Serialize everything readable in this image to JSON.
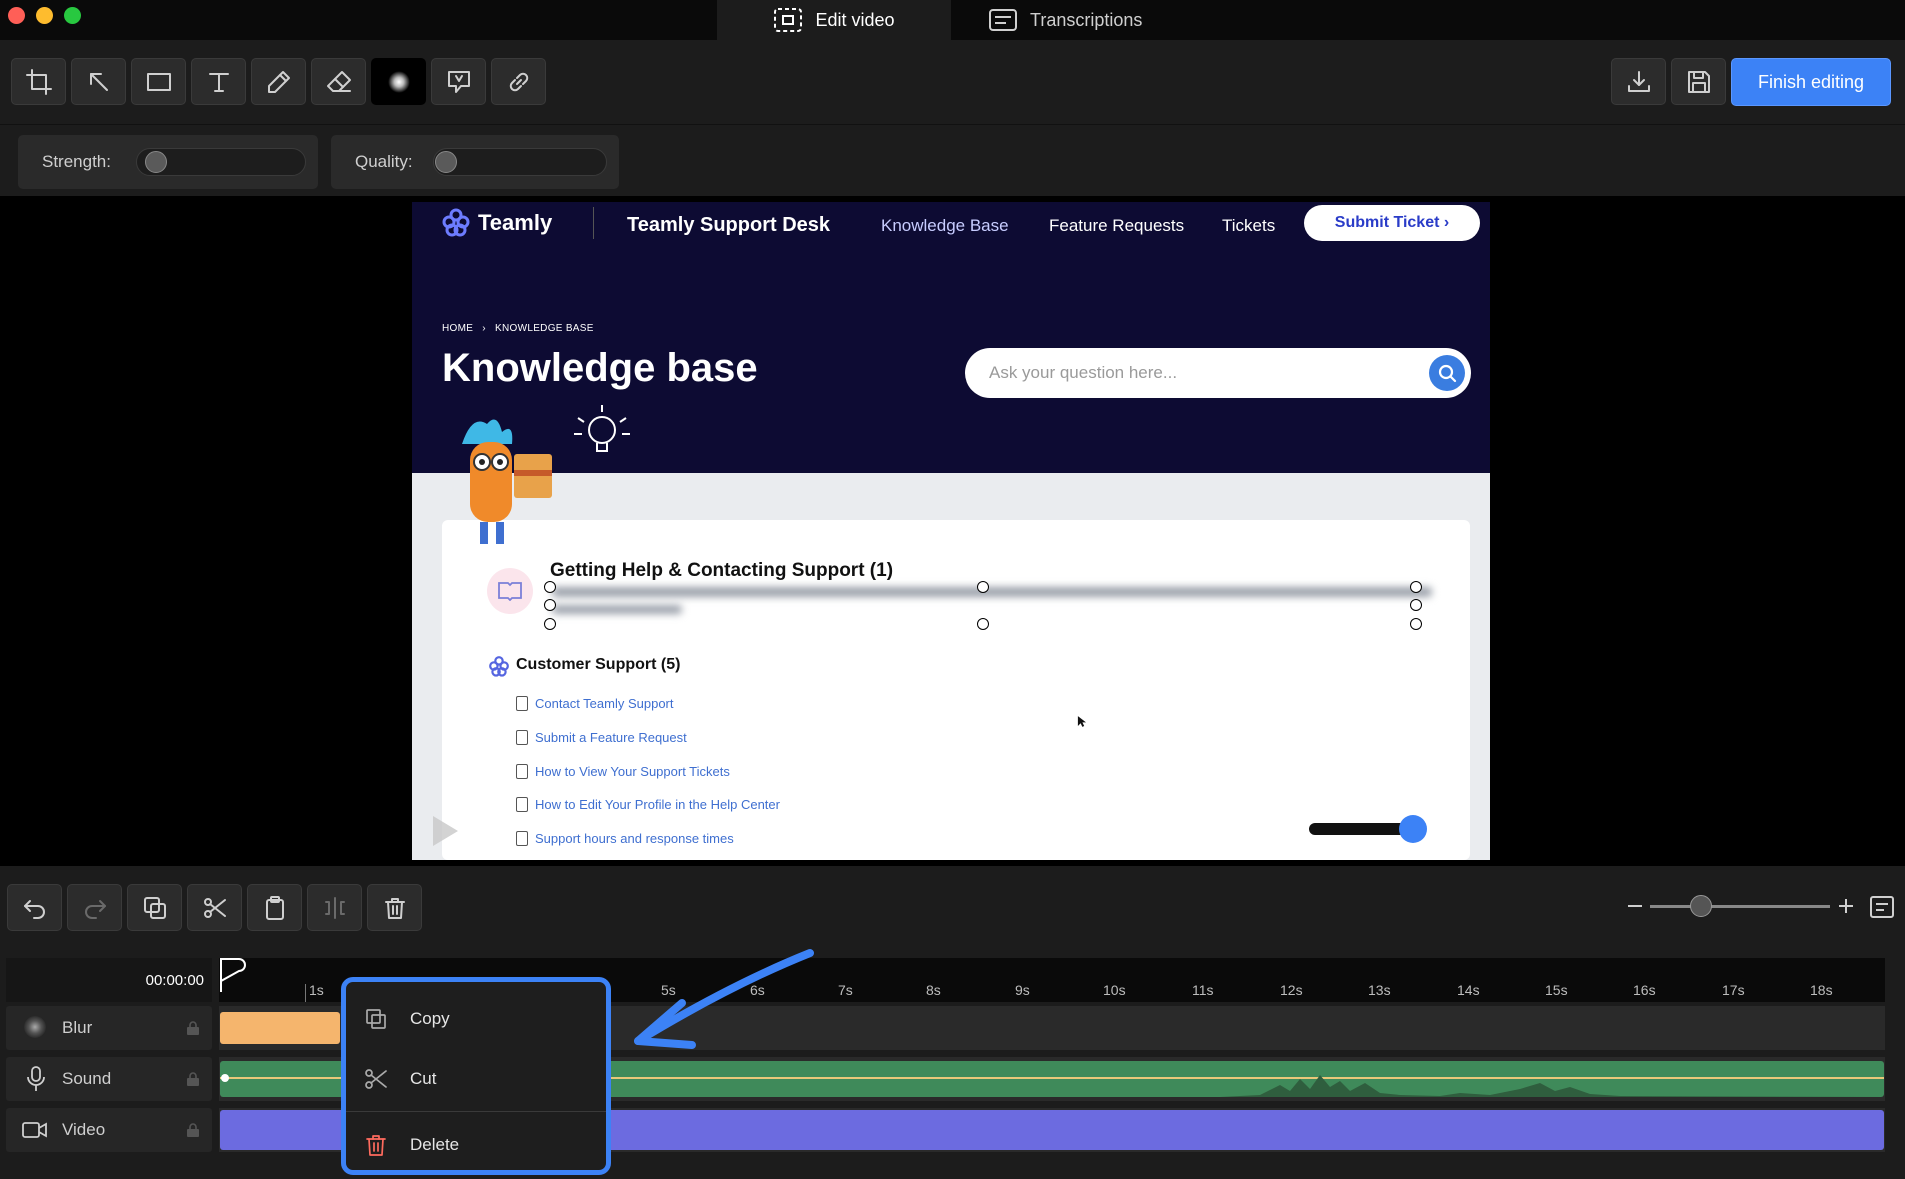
{
  "window": {
    "tabs": [
      {
        "label": "Edit video"
      },
      {
        "label": "Transcriptions"
      }
    ]
  },
  "toolbar": {
    "tools": [
      "crop-icon",
      "arrow-icon",
      "rectangle-icon",
      "text-icon",
      "pencil-icon",
      "eraser-icon",
      "blur-icon",
      "callout-icon",
      "link-icon"
    ],
    "finish_label": "Finish editing"
  },
  "settings": {
    "strength_label": "Strength:",
    "quality_label": "Quality:"
  },
  "preview": {
    "brand": "Teamly",
    "site_title": "Teamly Support Desk",
    "nav": [
      "Knowledge Base",
      "Feature Requests",
      "Tickets"
    ],
    "submit_ticket": "Submit Ticket ›",
    "breadcrumb_home": "HOME",
    "breadcrumb_sep": "›",
    "breadcrumb_current": "KNOWLEDGE BASE",
    "hero_title": "Knowledge base",
    "search_placeholder": "Ask your question here...",
    "section1_title": "Getting Help & Contacting Support (1)",
    "section2_title": "Customer Support (5)",
    "links": [
      "Contact Teamly Support",
      "Submit a Feature Request",
      "How to View Your Support Tickets",
      "How to Edit Your Profile in the Help Center",
      "Support hours and response times"
    ]
  },
  "timeline": {
    "timecode": "00:00:00",
    "ticks": [
      "1s",
      "5s",
      "6s",
      "7s",
      "8s",
      "9s",
      "10s",
      "11s",
      "12s",
      "13s",
      "14s",
      "15s",
      "16s",
      "17s",
      "18s"
    ],
    "tracks": [
      {
        "label": "Blur"
      },
      {
        "label": "Sound"
      },
      {
        "label": "Video"
      }
    ]
  },
  "context_menu": {
    "copy": "Copy",
    "cut": "Cut",
    "delete": "Delete"
  },
  "colors": {
    "accent": "#3c82f6",
    "blur_clip": "#f5b56d",
    "sound_clip": "#3f8a5a",
    "video_clip": "#6c6be0",
    "preview_header": "#0d0b33"
  }
}
